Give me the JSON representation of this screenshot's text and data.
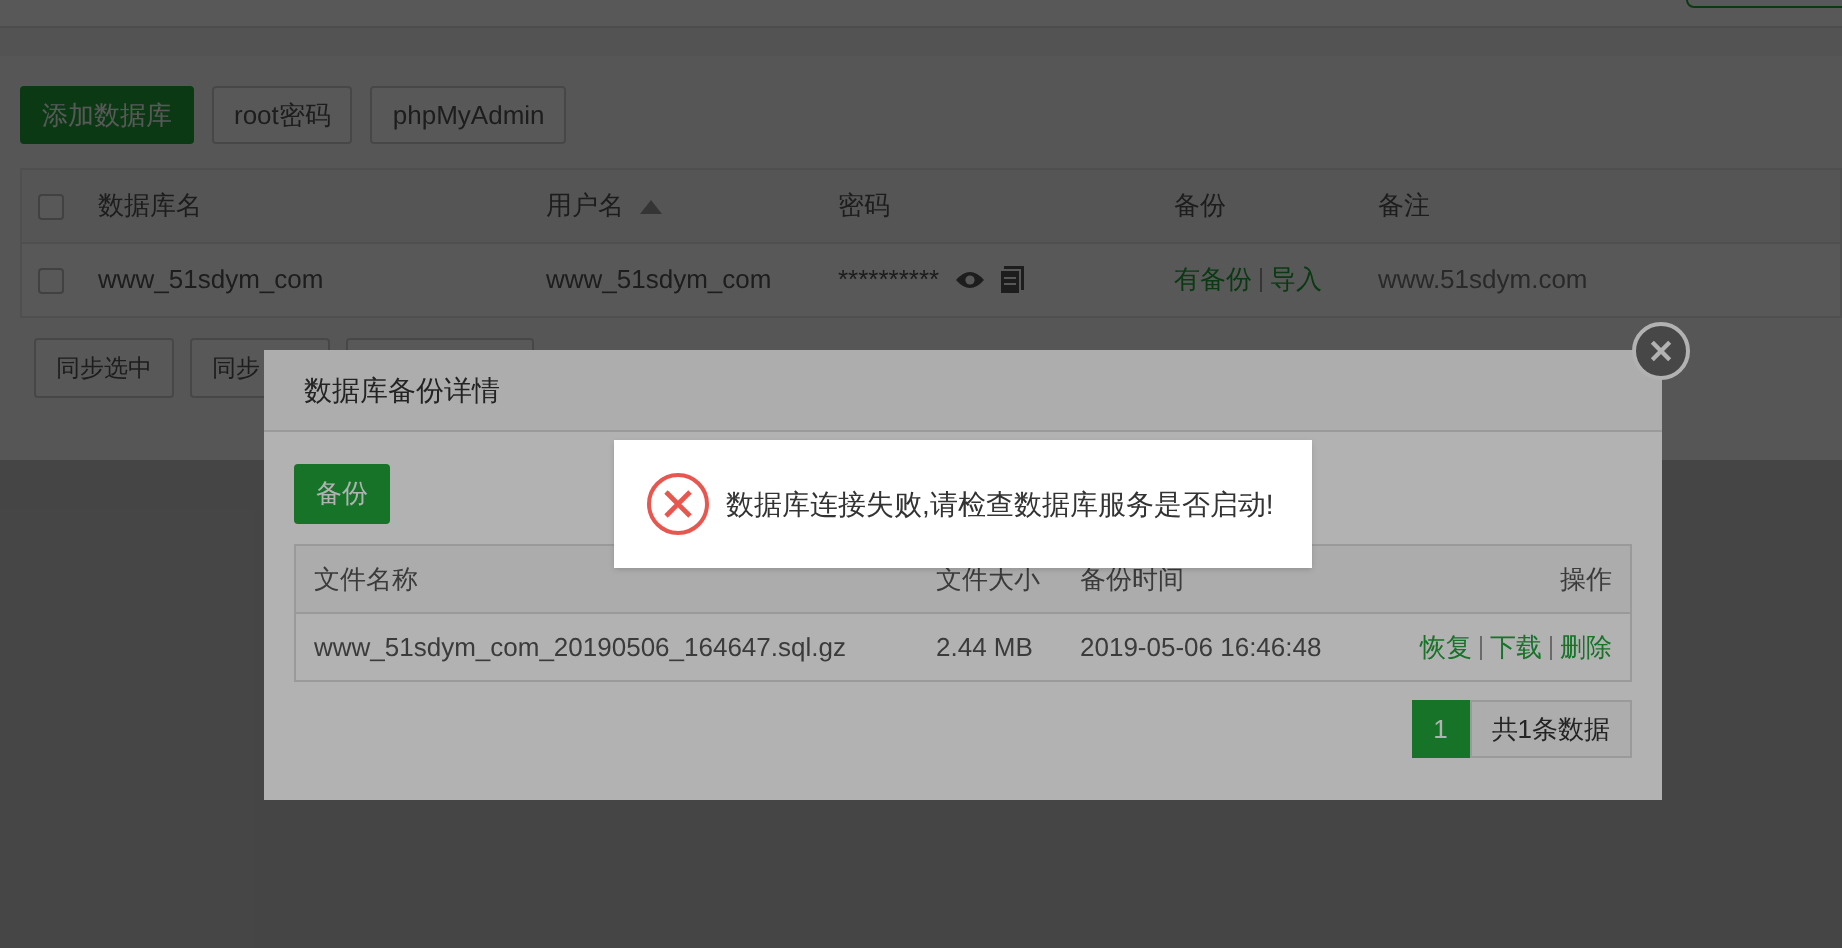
{
  "toolbar": {
    "buttons": [
      {
        "label": "添加数据库",
        "kind": "primary"
      },
      {
        "label": "root密码",
        "kind": "default"
      },
      {
        "label": "phpMyAdmin",
        "kind": "default"
      }
    ]
  },
  "table": {
    "columns": [
      {
        "label": "数据库名",
        "sorted": false
      },
      {
        "label": "用户名",
        "sorted": true
      },
      {
        "label": "密码",
        "sorted": false
      },
      {
        "label": "备份",
        "sorted": false
      },
      {
        "label": "备注",
        "sorted": false
      }
    ],
    "rows": [
      {
        "checked": false,
        "name": "www_51sdym_com",
        "user": "www_51sdym_com",
        "password": "**********",
        "backup": "有备份",
        "import": "导入",
        "note": "www.51sdym.com"
      }
    ],
    "header_checked": false
  },
  "bulk_buttons": [
    "同步选中",
    "同步"
  ],
  "dialog": {
    "title": "数据库备份详情",
    "backup_button": "备份",
    "columns": [
      "文件名称",
      "文件大小",
      "备份时间",
      "操作"
    ],
    "rows": [
      {
        "file": "www_51sdym_com_20190506_164647.sql.gz",
        "size": "2.44 MB",
        "time": "2019-05-06 16:46:48",
        "actions": [
          "恢复",
          "下载",
          "删除"
        ]
      }
    ],
    "pagination": {
      "pages": [
        {
          "label": "1",
          "selected": true
        }
      ],
      "summary": "共1条数据"
    }
  },
  "toast": {
    "message": "数据库连接失败,请检查数据库服务是否启动!"
  }
}
